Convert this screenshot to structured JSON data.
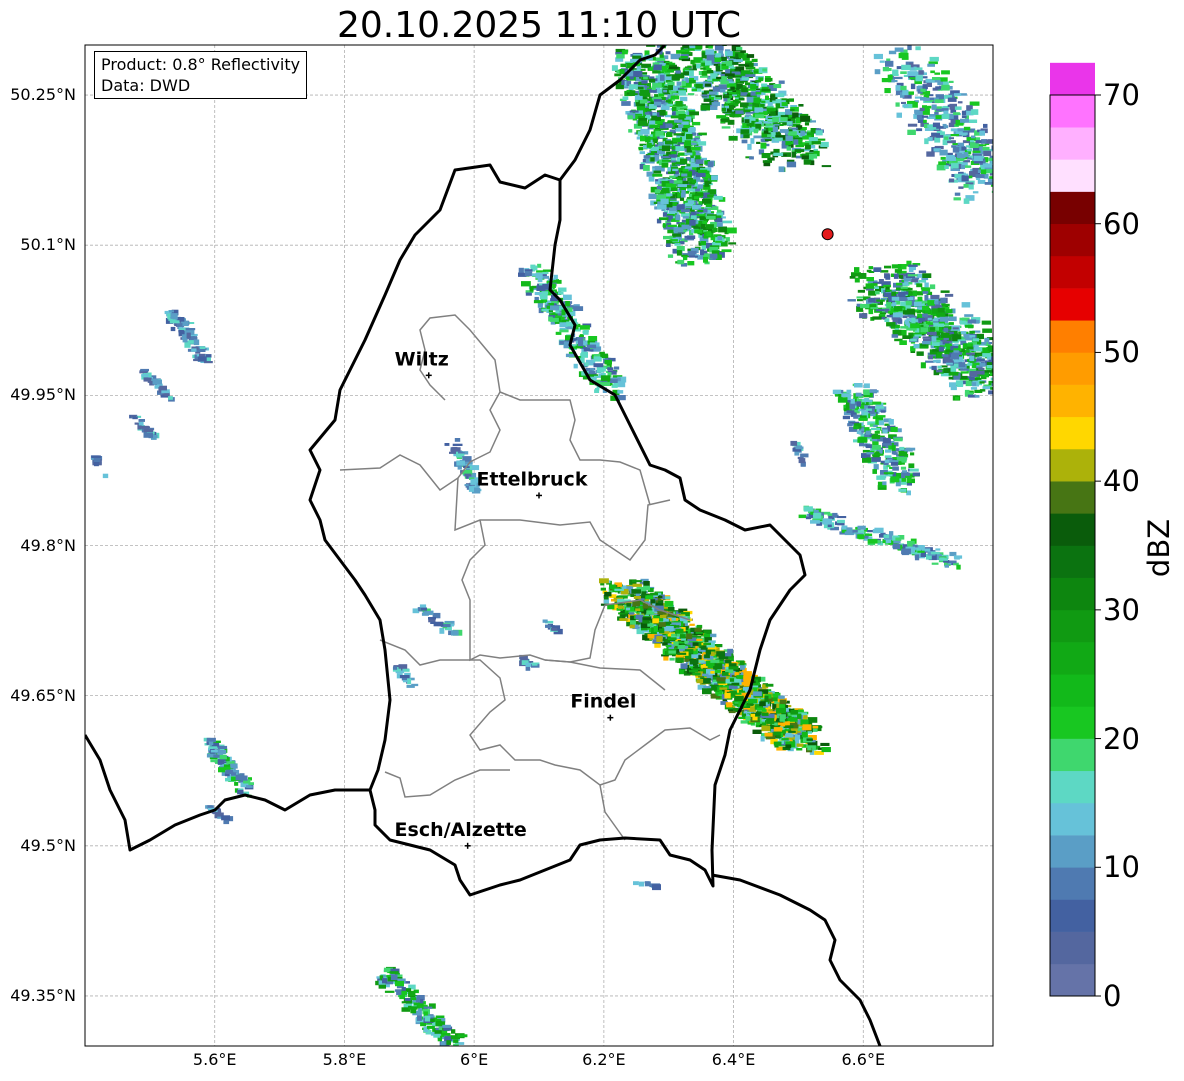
{
  "title": "20.10.2025 11:10 UTC",
  "info": {
    "product": "Product: 0.8° Reflectivity",
    "data": "Data: DWD"
  },
  "axes": {
    "lat_labels": [
      "50.25°N",
      "50.1°N",
      "49.95°N",
      "49.8°N",
      "49.65°N",
      "49.5°N",
      "49.35°N"
    ],
    "lon_labels": [
      "5.6°E",
      "5.8°E",
      "6°E",
      "6.2°E",
      "6.4°E",
      "6.6°E"
    ],
    "lat_values": [
      50.25,
      50.1,
      49.95,
      49.8,
      49.65,
      49.5,
      49.35
    ],
    "lon_values": [
      5.6,
      5.8,
      6.0,
      6.2,
      6.4,
      6.6
    ],
    "lon_range": [
      5.4,
      6.8
    ],
    "lat_range": [
      49.3,
      50.3
    ],
    "grid": true
  },
  "cities": [
    {
      "name": "Wiltz",
      "lon": 5.93,
      "lat": 49.97
    },
    {
      "name": "Ettelbruck",
      "lon": 6.1,
      "lat": 49.85
    },
    {
      "name": "Findel",
      "lon": 6.21,
      "lat": 49.628
    },
    {
      "name": "Esch/Alzette",
      "lon": 5.99,
      "lat": 49.5
    }
  ],
  "radar_marker": {
    "lon": 6.545,
    "lat": 50.111,
    "color": "#e41a1c"
  },
  "colorbar": {
    "label": "dBZ",
    "ticks": [
      "0",
      "10",
      "20",
      "30",
      "40",
      "50",
      "60",
      "70"
    ],
    "min": 0,
    "max": 70,
    "step": 2.5,
    "colors": [
      "#6573a8",
      "#54679f",
      "#4361a1",
      "#4f7ab1",
      "#5a9ec6",
      "#66c2d9",
      "#5dd8c4",
      "#3fd76e",
      "#18c721",
      "#12b91a",
      "#11a915",
      "#109a12",
      "#0d860f",
      "#0b7310",
      "#0a5c0b",
      "#477514",
      "#acb20a",
      "#ffd700",
      "#ffb300",
      "#ff9c00",
      "#ff7f00",
      "#e60000",
      "#c20000",
      "#9e0000",
      "#780000",
      "#ffe0ff",
      "#ffb0ff",
      "#ff73ff",
      "#ea35ea"
    ]
  },
  "colors": {
    "border": "#000000",
    "region_border": "#808080",
    "grid": "#b0b0b0"
  }
}
